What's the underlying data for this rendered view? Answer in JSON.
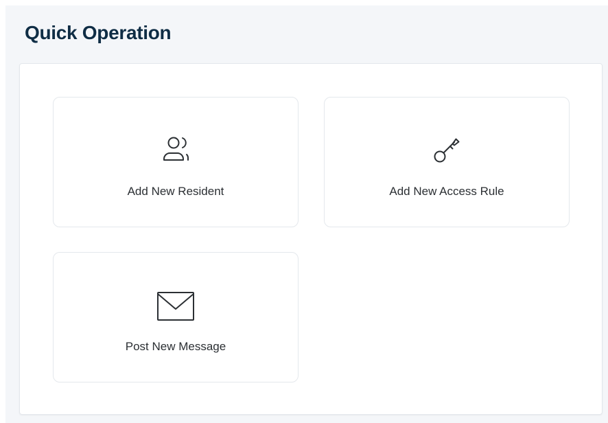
{
  "header": {
    "title": "Quick Operation"
  },
  "quick_actions": [
    {
      "label": "Add New Resident",
      "icon": "users-icon"
    },
    {
      "label": "Add New Access Rule",
      "icon": "key-icon"
    },
    {
      "label": "Post New Message",
      "icon": "mail-icon"
    }
  ],
  "colors": {
    "title": "#0f2d45",
    "icon": "#2b2f33",
    "page_background": "#f4f6f9",
    "card_border": "#e4e8ec"
  }
}
